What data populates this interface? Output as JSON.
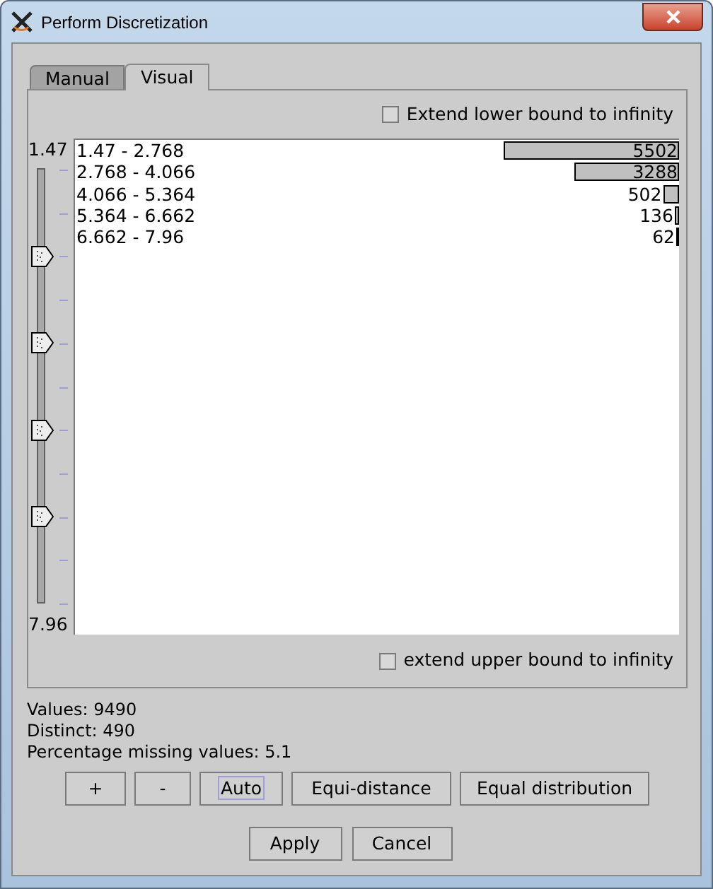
{
  "window": {
    "title": "Perform Discretization"
  },
  "tabs": [
    {
      "label": "Manual",
      "selected": false
    },
    {
      "label": "Visual",
      "selected": true
    }
  ],
  "extend_lower": {
    "label": "Extend lower bound to infinity",
    "checked": false
  },
  "slider": {
    "min_label": "1.47",
    "max_label": "7.96"
  },
  "bins": [
    {
      "range": "1.47 - 2.768",
      "count": "5502"
    },
    {
      "range": "2.768 - 4.066",
      "count": "3288"
    },
    {
      "range": "4.066 - 5.364",
      "count": "502"
    },
    {
      "range": "5.364 - 6.662",
      "count": "136"
    },
    {
      "range": "6.662 - 7.96",
      "count": "62"
    }
  ],
  "extend_upper": {
    "label": "extend upper bound to infinity",
    "checked": false
  },
  "stats": [
    "Values: 9490",
    "Distinct: 490",
    "Percentage missing values: 5.1"
  ],
  "tool_buttons": [
    {
      "label": "+",
      "focused": false
    },
    {
      "label": "-",
      "focused": false
    },
    {
      "label": "Auto",
      "focused": true
    },
    {
      "label": "Equi-distance",
      "focused": false
    },
    {
      "label": "Equal distribution",
      "focused": false
    }
  ],
  "dialog_buttons": [
    "Apply",
    "Cancel"
  ]
}
